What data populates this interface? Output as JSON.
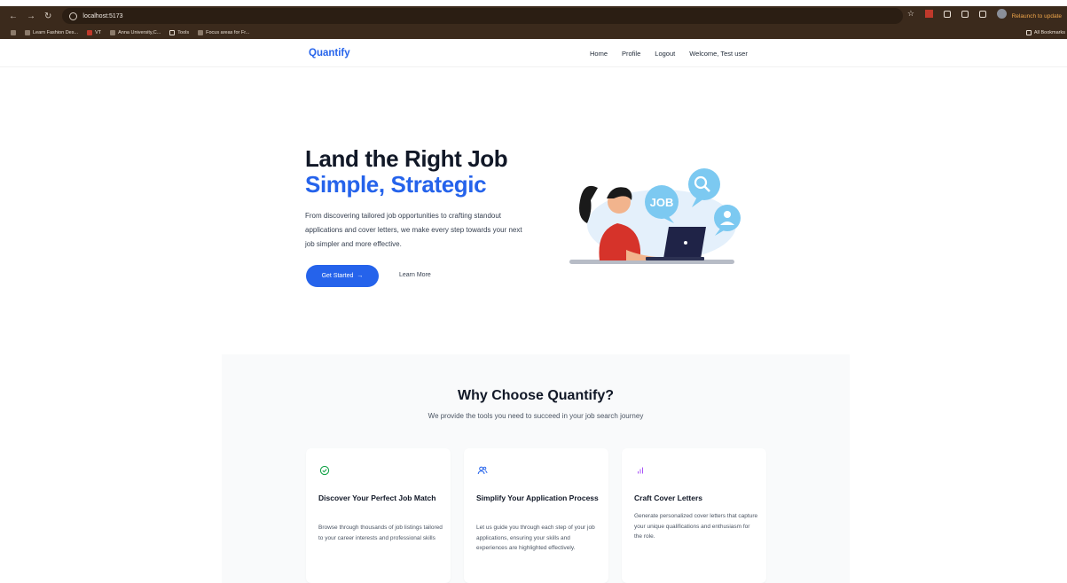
{
  "browser": {
    "url": "localhost:5173",
    "relaunch_label": "Relaunch to update",
    "bookmarks": [
      "Learn Fashion Des...",
      "VT",
      "Anna University,C...",
      "Tools",
      "Focus areas for Fr..."
    ],
    "all_bookmarks": "All Bookmarks"
  },
  "nav": {
    "brand": "Quantify",
    "links": [
      "Home",
      "Profile",
      "Logout"
    ],
    "welcome": "Welcome, Test user"
  },
  "hero": {
    "title_line1": "Land the Right Job",
    "title_line2": "Simple, Strategic",
    "description": "From discovering tailored job opportunities to crafting standout applications and cover letters, we make every step towards your next job simpler and more effective.",
    "primary_button": "Get Started",
    "secondary_button": "Learn More",
    "illustration_text": "JOB"
  },
  "features": {
    "title": "Why Choose Quantify?",
    "subtitle": "We provide the tools you need to succeed in your job search journey",
    "cards": [
      {
        "icon": "check-circle-icon",
        "title": "Discover Your Perfect Job Match",
        "description": "Browse through thousands of job listings tailored to your career interests and professional skills"
      },
      {
        "icon": "users-icon",
        "title": "Simplify Your Application Process",
        "description": "Let us guide you through each step of your job applications, ensuring your skills and experiences are highlighted effectively."
      },
      {
        "icon": "bar-chart-icon",
        "title": "Craft Cover Letters",
        "description": "Generate personalized cover letters that capture your unique qualifications and enthusiasm for the role."
      }
    ]
  },
  "colors": {
    "accent": "#2563eb",
    "browser_chrome": "#3b2a1c",
    "feature_bg": "#f9fafb"
  }
}
